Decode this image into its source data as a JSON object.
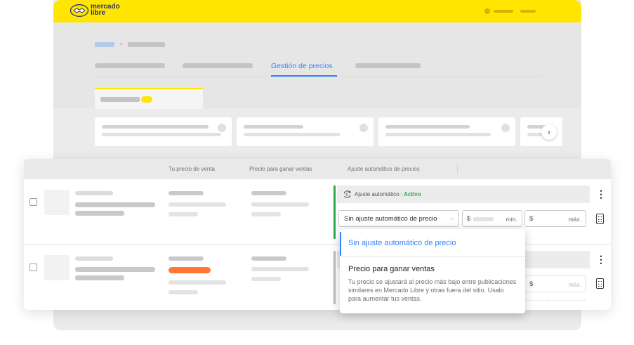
{
  "brand": {
    "name_line1": "mercado",
    "name_line2": "libre",
    "color": "#ffe600",
    "text_color": "#2d3277"
  },
  "nav": {
    "active_tab": "Gestión de precios",
    "accent": "#3483fa"
  },
  "table": {
    "headers": [
      "Tu precio de venta",
      "Precio para ganar ventas",
      "Ajuste automático de precios"
    ]
  },
  "adjustment": {
    "label": "Ajuste automático",
    "separator": "|",
    "status": "Activo",
    "status_color": "#2fa84f",
    "select_value": "Sin ajuste automático de precio",
    "currency": "$",
    "min_unit": "mín.",
    "max_unit": "máx.",
    "icon": "auto-adjust-icon"
  },
  "dropdown": {
    "options": [
      {
        "label": "Sin ajuste automático de precio"
      },
      {
        "label": "Precio para ganar ventas",
        "description": "Tu precio se ajustará al precio más bajo entre publicaciones similares en Mercado Libre y otras fuera del sitio. Usalo para aumentar tus ventas."
      }
    ]
  },
  "row2": {
    "currency": "$",
    "max_unit": "máx.",
    "badge_color": "#ff7733"
  },
  "icons": [
    "handshake-logo-icon",
    "chevron-right-icon",
    "kebab-menu-icon",
    "calculator-icon",
    "chevron-down-icon"
  ]
}
